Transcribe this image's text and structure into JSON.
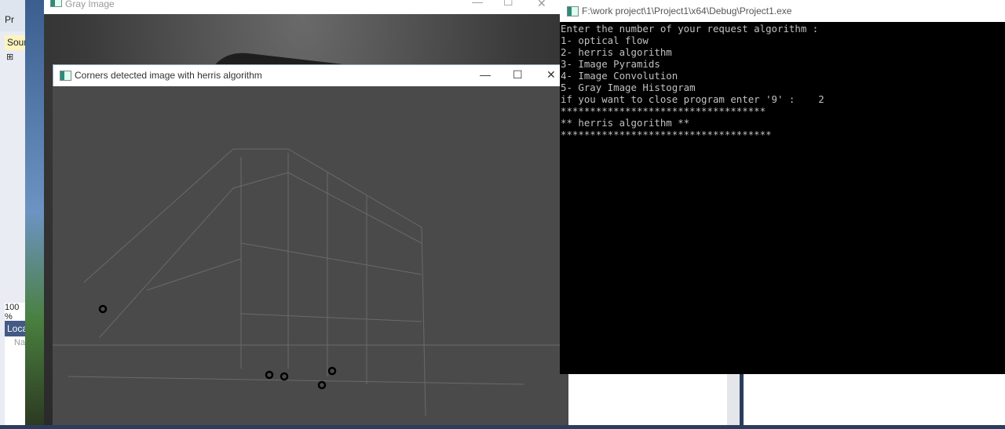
{
  "background_app": {
    "project_label": "Pr",
    "source_tab": "Sour",
    "zoom_level": "100 %",
    "locals_tab": "Loca",
    "name_column": "Name"
  },
  "gray_window": {
    "title": "Gray Image"
  },
  "herris_window": {
    "title": "Corners detected image with herris algorithm"
  },
  "console": {
    "title": "F:\\work project\\1\\Project1\\x64\\Debug\\Project1.exe",
    "lines": [
      "Enter the number of your request algorithm :",
      "1- optical flow",
      "2- herris algorithm",
      "3- Image Pyramids",
      "4- Image Convolution",
      "5- Gray Image Histogram",
      "if you want to close program enter '9' :    2",
      "***********************************",
      "** herris algorithm **",
      "************************************"
    ]
  },
  "controls": {
    "minimize": "—",
    "maximize": "☐",
    "close": "✕"
  }
}
